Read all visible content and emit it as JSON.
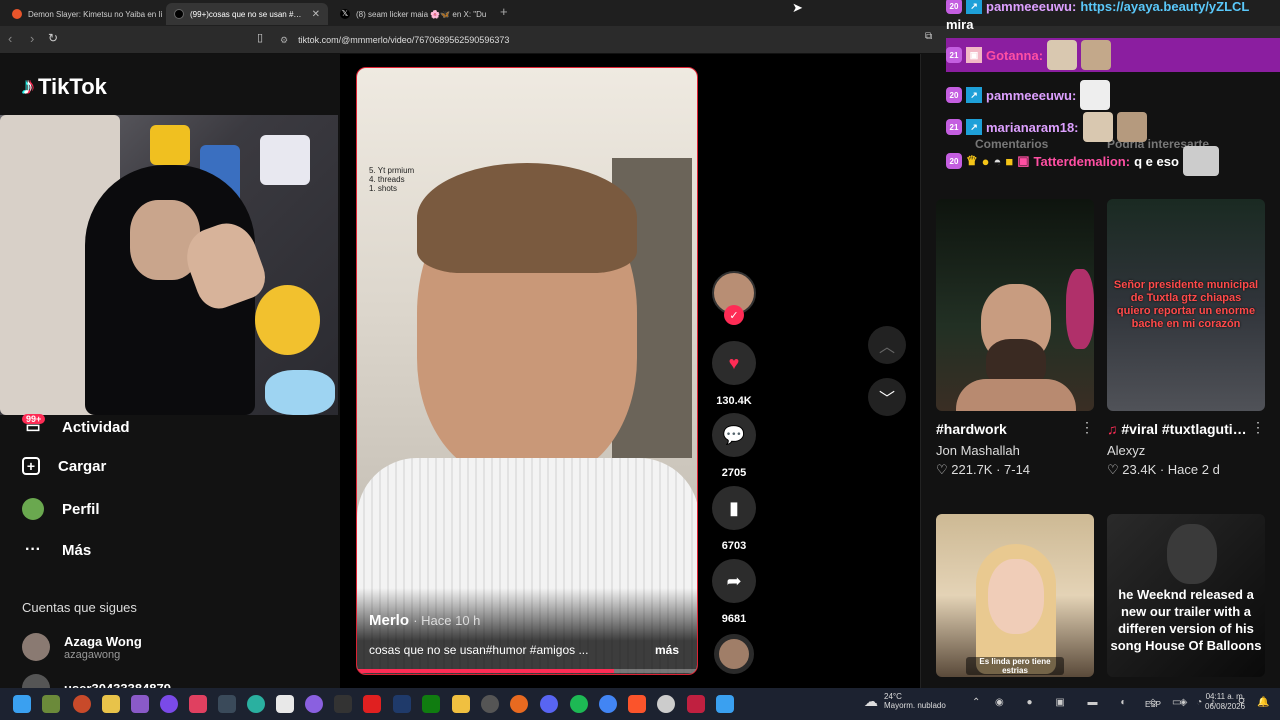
{
  "browser": {
    "tabs": [
      {
        "title": "Demon Slayer: Kimetsu no Yaiba en línea",
        "color": "#e8552b",
        "active": false
      },
      {
        "title": "(99+)cosas que no se usan #humor",
        "color": "#111111",
        "active": true
      },
      {
        "title": "(8) seam licker maia 🌸🦋 en X: \"Du",
        "color": "#000000",
        "active": false
      }
    ],
    "new_tab": "+",
    "url": "tiktok.com/@mmmerlo/video/7670689562590596373"
  },
  "sidebar": {
    "logo": "TikTok",
    "badge": "99+",
    "nav": [
      {
        "label": "Actividad",
        "icon": "message-icon"
      },
      {
        "label": "Cargar",
        "icon": "plus-square-icon"
      },
      {
        "label": "Perfil",
        "icon": "profile-avatar-icon"
      },
      {
        "label": "Más",
        "icon": "more-dots-icon"
      }
    ],
    "following_heading": "Cuentas que sigues",
    "following": [
      {
        "name": "Azaga Wong",
        "handle": "azagawong"
      },
      {
        "name": "user30433384879...",
        "handle": ""
      }
    ]
  },
  "video": {
    "overlay_lines": [
      "5. Yt prmium",
      "4. threads",
      "1. shots"
    ],
    "author": "Merlo",
    "time": "· Hace 10 h",
    "caption": "cosas que no se usan#humor #amigos ...",
    "more": "más",
    "progress": 0.75
  },
  "actions": {
    "likes": "130.4K",
    "comments": "2705",
    "saves": "6703",
    "shares": "9681"
  },
  "chat": {
    "lines": [
      {
        "badge": "20",
        "user": "pammeeeuwu:",
        "text": "https://ayaya.beauty/yZLCL",
        "color": "#5ac8fa"
      },
      {
        "badge": "",
        "user": "",
        "text": "mira",
        "color": "#ffffff"
      },
      {
        "badge": "21",
        "user": "Gotanna:",
        "text": "",
        "color": "#ff4fa3"
      },
      {
        "badge": "20",
        "user": "pammeeeuwu:",
        "text": "",
        "color": "#dda0ff"
      },
      {
        "badge": "21",
        "user": "marianaram18:",
        "text": "",
        "color": "#dda0ff"
      },
      {
        "badge": "20",
        "user": "Tatterdemalion:",
        "text": "q e eso",
        "color": "#ff4fa3"
      }
    ],
    "hint_comments": "Comentarios",
    "hint_suggested": "Podría interesarte"
  },
  "cards": [
    {
      "title": "#hardwork",
      "author": "Jon Mashallah",
      "stats": "♡ 221.7K · 7-14",
      "thumb_text": "",
      "thumb_color": "#1c2a1a"
    },
    {
      "title": "#viral #tuxtlagutierrez #f...",
      "author": "Alexyz",
      "stats": "♡ 23.4K · Hace 2 d",
      "thumb_text": "Señor presidente municipal de Tuxtla gtz chiapas quiero reportar un enorme bache en mi corazón",
      "thumb_color": "#2a2c30"
    },
    {
      "title": "",
      "author": "",
      "stats": "",
      "thumb_text": "Es linda pero tiene estrias",
      "thumb_color": "#d8c4a0"
    },
    {
      "title": "",
      "author": "",
      "stats": "",
      "thumb_text": "he Weeknd released a new our trailer with a differen version of his song House Of Balloons",
      "thumb_color": "#161616"
    }
  ],
  "taskbar": {
    "weather_temp": "24°C",
    "weather_desc": "Mayorm. nublado",
    "lang": "ESP",
    "time": "04:11 a. m.",
    "date": "06/08/2026"
  }
}
